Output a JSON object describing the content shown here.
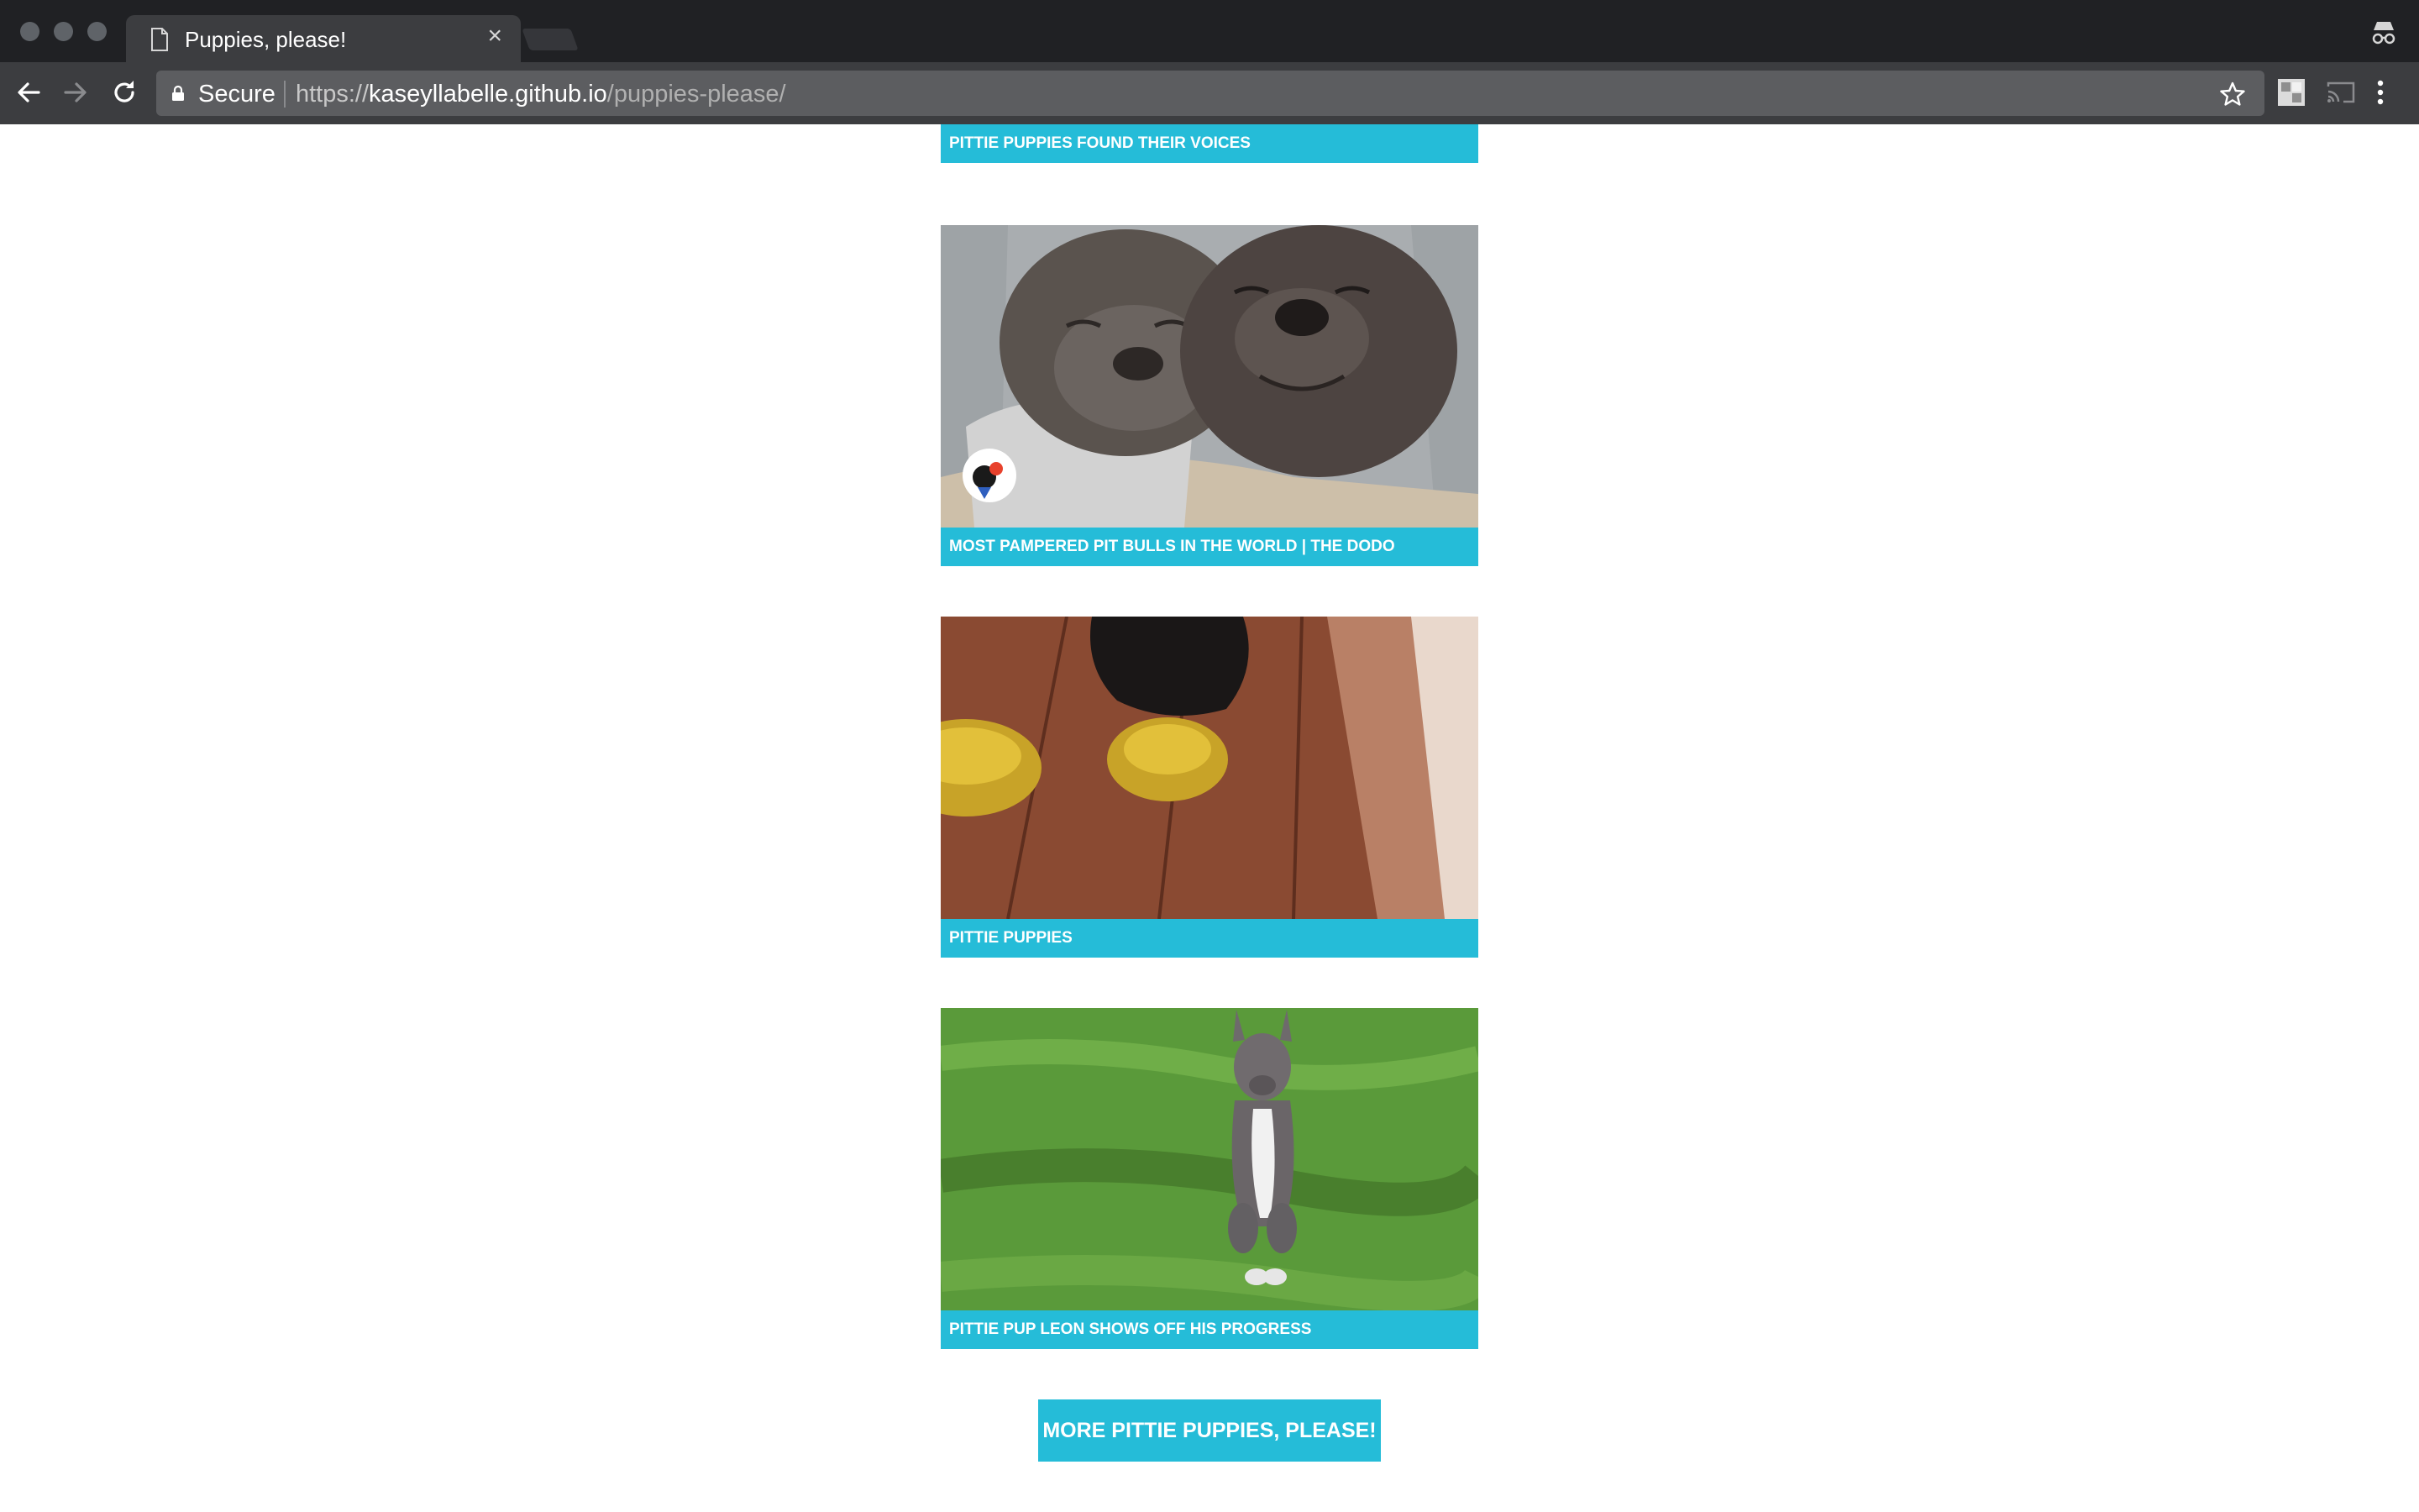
{
  "browser": {
    "tab_title": "Puppies, please!",
    "tab_close": "×",
    "security_label": "Secure",
    "url": {
      "scheme": "https://",
      "host": "kaseyllabelle.github.io",
      "path": "/puppies-please/"
    }
  },
  "videos": [
    {
      "caption": "PITTIE PUPPIES FOUND THEIR VOICES"
    },
    {
      "caption": "MOST PAMPERED PIT BULLS IN THE WORLD | THE DODO"
    },
    {
      "caption": "PITTIE PUPPIES"
    },
    {
      "caption": "PITTIE PUP LEON SHOWS OFF HIS PROGRESS"
    }
  ],
  "more_button": {
    "label": "MORE PITTIE PUPPIES, PLEASE!"
  },
  "colors": {
    "accent": "#25bcd8",
    "chrome_dark": "#202124",
    "toolbar": "#3c3d40",
    "omnibox": "#5c5d60"
  }
}
